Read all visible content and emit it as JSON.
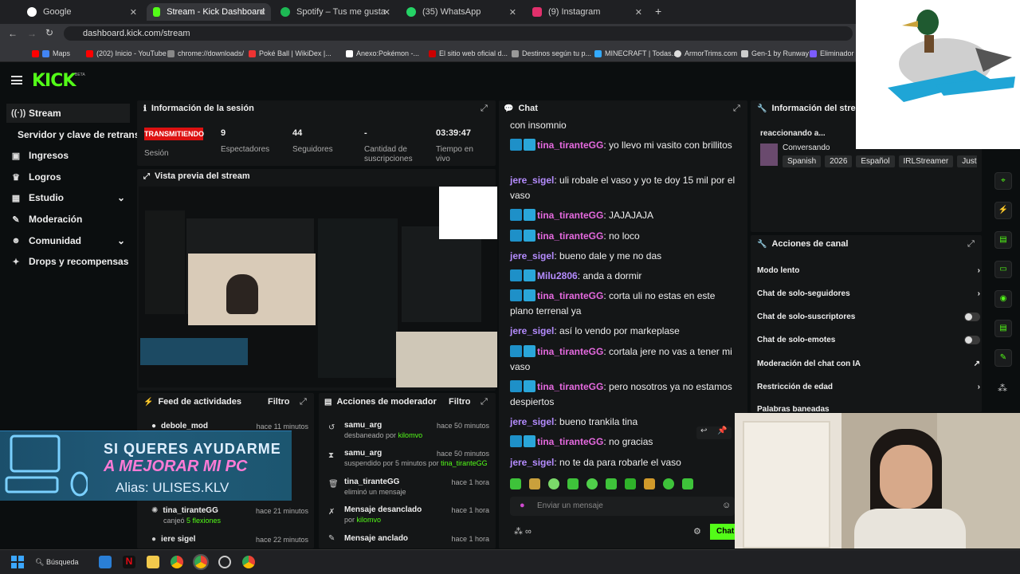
{
  "browser": {
    "tabs": [
      {
        "label": "Google",
        "color": "#ffffff"
      },
      {
        "label": "Stream - Kick Dashboard",
        "color": "#53fc18"
      },
      {
        "label": "Spotify – Tus me gusta",
        "color": "#1db954"
      },
      {
        "label": "(35) WhatsApp",
        "color": "#25d366"
      },
      {
        "label": "(9) Instagram",
        "color": "#e1306c"
      }
    ],
    "url": "dashboard.kick.com/stream",
    "bookmarks": [
      "Maps",
      "(202) Inicio - YouTube",
      "chrome://downloads/",
      "Poké Ball | WikiDex |...",
      "Anexo:Pokémon -...",
      "El sitio web oficial d...",
      "Destinos según tu p...",
      "MINECRAFT | Todas...",
      "ArmorTrims.com",
      "Gen-1 by Runway",
      "Eliminador d"
    ]
  },
  "brand": {
    "logo": "KICK",
    "beta": "BETA",
    "accent": "#53fc18"
  },
  "sidebar": {
    "items": [
      "Stream",
      "Servidor y clave de retransmisión",
      "Ingresos",
      "Logros",
      "Estudio",
      "Moderación",
      "Comunidad",
      "Drops y recompensas"
    ]
  },
  "session": {
    "title": "Información de la sesión",
    "status": "TRANSMITIENDO",
    "status_label": "Sesión",
    "viewers": "9",
    "viewers_label": "Espectadores",
    "followers": "44",
    "followers_label": "Seguidores",
    "subs": "-",
    "subs_label": "Cantidad de suscripciones",
    "time": "03:39:47",
    "time_label": "Tiempo en vivo"
  },
  "preview": {
    "title": "Vista previa del stream"
  },
  "chat": {
    "title": "Chat",
    "messages": [
      {
        "user": "",
        "text": "con insomnio",
        "color": "white",
        "badge": false
      },
      {
        "user": "tina_tiranteGG",
        "text": ": yo llevo mi vasito con brillitos",
        "color": "pink",
        "badge": true
      },
      {
        "user": "jere_sigel",
        "text": ": uli robale el vaso y yo te doy 15 mil por el vaso",
        "color": "purple",
        "badge": false
      },
      {
        "user": "tina_tiranteGG",
        "text": ": JAJAJAJA",
        "color": "pink",
        "badge": true
      },
      {
        "user": "tina_tiranteGG",
        "text": ": no loco",
        "color": "pink",
        "badge": true
      },
      {
        "user": "jere_sigel",
        "text": ": bueno dale y me no das",
        "color": "purple",
        "badge": false
      },
      {
        "user": "Milu2806",
        "text": ": anda a dormir",
        "color": "purple",
        "badge": true
      },
      {
        "user": "tina_tiranteGG",
        "text": ": corta uli no estas en este plano terrenal ya",
        "color": "pink",
        "badge": true
      },
      {
        "user": "jere_sigel",
        "text": ": así lo vendo por markeplase",
        "color": "purple",
        "badge": false
      },
      {
        "user": "tina_tiranteGG",
        "text": ": cortala jere no vas a tener mi vaso",
        "color": "pink",
        "badge": true
      },
      {
        "user": "tina_tiranteGG",
        "text": ": pero nosotros ya no estamos despiertos",
        "color": "pink",
        "badge": true
      },
      {
        "user": "jere_sigel",
        "text": ": bueno trankila tina",
        "color": "purple",
        "badge": false
      },
      {
        "user": "tina_tiranteGG",
        "text": ": no gracias",
        "color": "pink",
        "badge": true
      },
      {
        "user": "jere_sigel",
        "text": ": no te da para robarle el vaso",
        "color": "purple",
        "badge": false
      }
    ],
    "placeholder": "Enviar un mensaje",
    "send": "Chat"
  },
  "stream_info": {
    "title": "Información del stream",
    "reacting": "reaccionando a...",
    "category": "Conversando",
    "tags": [
      "Spanish",
      "2026",
      "Español",
      "IRLStreamer",
      "JustC"
    ]
  },
  "channel_actions": {
    "title": "Acciones de canal",
    "items": [
      "Modo lento",
      "Chat de solo-seguidores",
      "Chat de solo-suscriptores",
      "Chat de solo-emotes",
      "Moderación del chat con IA",
      "Restricción de edad",
      "Palabras baneadas"
    ]
  },
  "feed": {
    "title": "Feed de actividades",
    "filter": "Filtro",
    "rows": [
      {
        "user": "debole_mod",
        "time": "hace 11 minutos",
        "sub": ""
      },
      {
        "user": "tina_tiranteGG",
        "time": "hace 21 minutos",
        "sub": "canjeó 5 flexiones"
      },
      {
        "user": "iere sigel",
        "time": "hace 22 minutos",
        "sub": ""
      }
    ]
  },
  "modactions": {
    "title": "Acciones de moderador",
    "filter": "Filtro",
    "rows": [
      {
        "user": "samu_arg",
        "time": "hace 50 minutos",
        "sub": "desbaneado por kilomvo"
      },
      {
        "user": "samu_arg",
        "time": "hace 50 minutos",
        "sub": "suspendido por 5 minutos por tina_tiranteGG"
      },
      {
        "user": "tina_tiranteGG",
        "time": "hace 1 hora",
        "sub": "eliminó un mensaje"
      },
      {
        "user": "Mensaje desanclado",
        "time": "hace 1 hora",
        "sub": "por kilomvo"
      },
      {
        "user": "Mensaje anclado",
        "time": "hace 1 hora",
        "sub": ""
      }
    ]
  },
  "overlay": {
    "line1": "SI QUERES AYUDARME",
    "line2": "A MEJORAR MI PC",
    "line3": "Alias: ULISES.KLV"
  },
  "taskbar": {
    "search": "Búsqueda"
  }
}
